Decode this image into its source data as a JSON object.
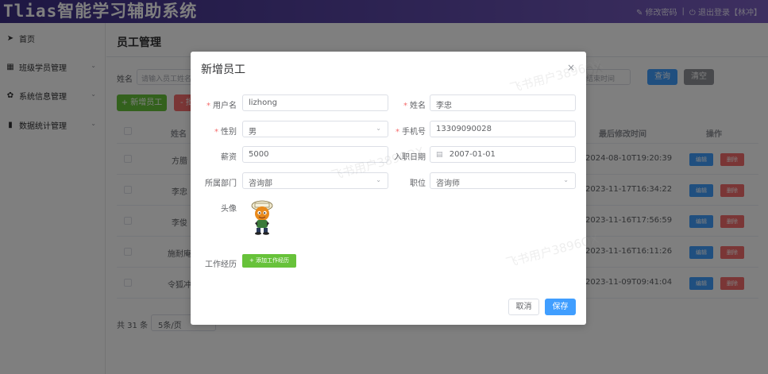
{
  "header": {
    "app_title": "Tlias智能学习辅助系统",
    "change_password": "修改密码",
    "separator": "|",
    "logout": "退出登录【林冲】",
    "edit_icon": "edit-icon",
    "power_icon": "power-icon"
  },
  "sidebar": {
    "items": [
      {
        "label": "首页",
        "icon": "send-icon"
      },
      {
        "label": "班级学员管理",
        "icon": "grid-icon"
      },
      {
        "label": "系统信息管理",
        "icon": "gear-icon"
      },
      {
        "label": "数据统计管理",
        "icon": "bar-chart-icon"
      }
    ]
  },
  "page": {
    "title": "员工管理",
    "search_label": "姓名",
    "search_placeholder": "请输入员工姓名",
    "date_placeholder": "结束时间",
    "query_button": "查询",
    "clear_button": "清空",
    "add_button": "+ 新增员工",
    "batch_delete_button": "- 批",
    "total": "共 31 条",
    "page_size": "5条/页"
  },
  "table": {
    "headers": {
      "name": "姓名",
      "updated": "最后修改时间",
      "actions": "操作"
    },
    "edit_label": "编辑",
    "delete_label": "删除",
    "rows": [
      {
        "name": "方腊",
        "updated": "2024-08-10T19:20:39"
      },
      {
        "name": "李忠",
        "updated": "2023-11-17T16:34:22"
      },
      {
        "name": "李俊",
        "updated": "2023-11-16T17:56:59"
      },
      {
        "name": "施耐庵",
        "updated": "2023-11-16T16:11:26"
      },
      {
        "name": "令狐冲",
        "updated": "2023-11-09T09:41:04"
      }
    ]
  },
  "dialog": {
    "title": "新增员工",
    "close": "×",
    "username_label": "用户名",
    "username_value": "lizhong",
    "name_label": "姓名",
    "name_value": "李忠",
    "gender_label": "性别",
    "gender_value": "男",
    "phone_label": "手机号",
    "phone_value": "13309090028",
    "salary_label": "薪资",
    "salary_value": "5000",
    "entry_date_label": "入职日期",
    "entry_date_value": "2007-01-01",
    "dept_label": "所属部门",
    "dept_value": "咨询部",
    "job_label": "职位",
    "job_value": "咨询师",
    "avatar_label": "头像",
    "exp_label": "工作经历",
    "add_exp_button": "+ 添加工作经历",
    "cancel_button": "取消",
    "save_button": "保存",
    "required_mark": "*"
  },
  "watermark": {
    "text": "飞书用户3896QX"
  },
  "colors": {
    "primary": "#409eff",
    "success": "#67c23a",
    "danger": "#f56c6c",
    "info": "#909399",
    "header": "#4a3796"
  }
}
